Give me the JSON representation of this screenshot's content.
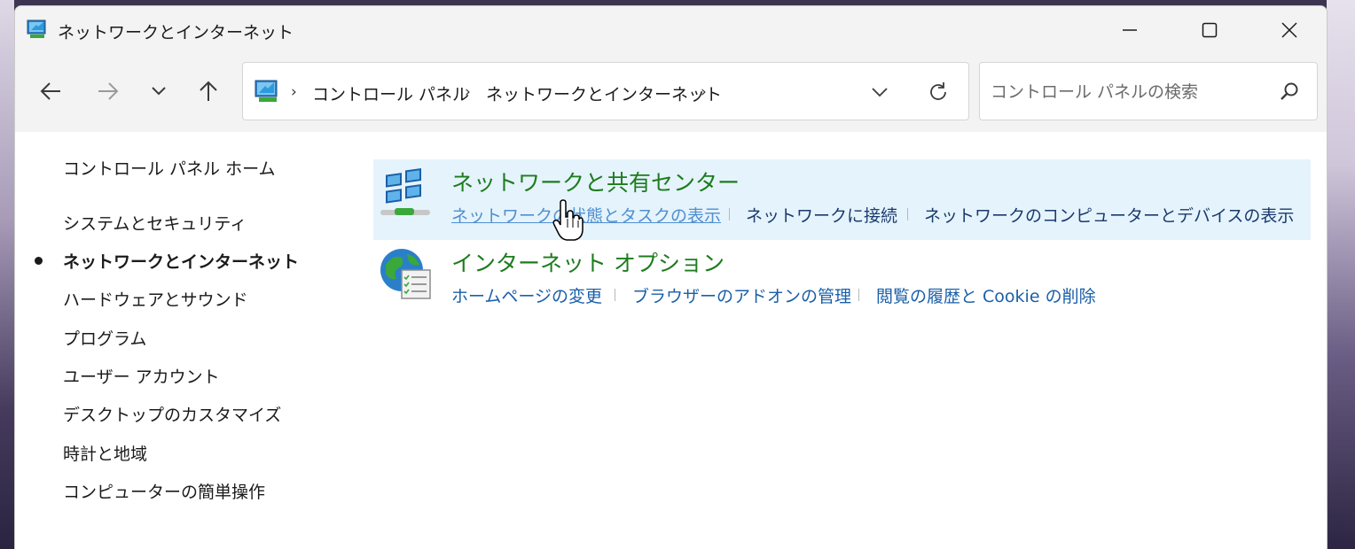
{
  "window": {
    "title": "ネットワークとインターネット"
  },
  "navigation": {
    "breadcrumb": [
      "コントロール パネル",
      "ネットワークとインターネット"
    ],
    "search_placeholder": "コントロール パネルの検索"
  },
  "sidebar": {
    "home_label": "コントロール パネル ホーム",
    "items": [
      {
        "label": "システムとセキュリティ",
        "active": false
      },
      {
        "label": "ネットワークとインターネット",
        "active": true
      },
      {
        "label": "ハードウェアとサウンド",
        "active": false
      },
      {
        "label": "プログラム",
        "active": false
      },
      {
        "label": "ユーザー アカウント",
        "active": false
      },
      {
        "label": "デスクトップのカスタマイズ",
        "active": false
      },
      {
        "label": "時計と地域",
        "active": false
      },
      {
        "label": "コンピューターの簡単操作",
        "active": false
      }
    ]
  },
  "categories": [
    {
      "title": "ネットワークと共有センター",
      "icon": "network-sharing-center-icon",
      "links": [
        "ネットワークの状態とタスクの表示",
        "ネットワークに接続",
        "ネットワークのコンピューターとデバイスの表示"
      ]
    },
    {
      "title": "インターネット オプション",
      "icon": "internet-options-icon",
      "links": [
        "ホームページの変更",
        "ブラウザーのアドオンの管理",
        "閲覧の履歴と Cookie の削除"
      ]
    }
  ],
  "colors": {
    "category_title": "#1d7c1d",
    "link": "#1a5fa8",
    "hover_link": "#4f8fd0",
    "highlight": "#e5f3fc"
  }
}
